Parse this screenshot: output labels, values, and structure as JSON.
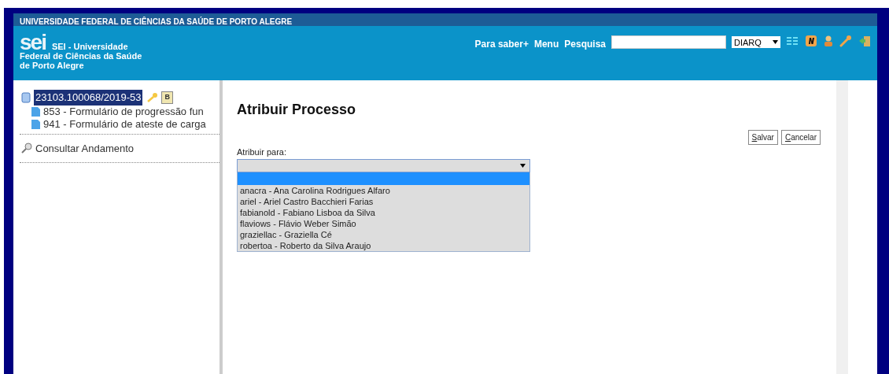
{
  "banner": {
    "title": "UNIVERSIDADE FEDERAL DE CIÊNCIAS DA SAÚDE DE PORTO ALEGRE"
  },
  "header": {
    "logo": "sei",
    "org_name_lines": [
      "SEI - Universidade",
      "Federal de Ciências da Saúde",
      "de Porto Alegre"
    ],
    "links": [
      "Para saber+",
      "Menu",
      "Pesquisa"
    ],
    "unit": "DIARQ"
  },
  "tree": {
    "label": "23103.100068/2019-53",
    "selected": true,
    "children": [
      {
        "label": "853 - Formulário de progressão fun",
        "selected": false
      },
      {
        "label": "941 - Formulário de ateste de carga",
        "selected": false
      }
    ]
  },
  "badge": "B",
  "sidebar_links": [
    "Consultar Andamento"
  ],
  "form": {
    "title": "Atribuir Processo",
    "buttons": [
      "Salvar",
      "Cancelar"
    ],
    "field_label": "Atribuir para:",
    "options": [
      {
        "selected": true
      },
      {
        "label": "anacra - Ana Carolina Rodrigues Alfaro",
        "selected": false
      },
      {
        "label": "ariel - Ariel Castro Bacchieri Farias",
        "selected": false
      },
      {
        "label": "fabianold - Fabiano Lisboa da Silva",
        "selected": false
      },
      {
        "label": "flaviows - Flávio Weber Simão",
        "selected": false
      },
      {
        "label": "graziellac - Graziella Cé",
        "selected": false
      },
      {
        "label": "robertoa - Roberto da Silva Araujo",
        "selected": false
      }
    ]
  }
}
